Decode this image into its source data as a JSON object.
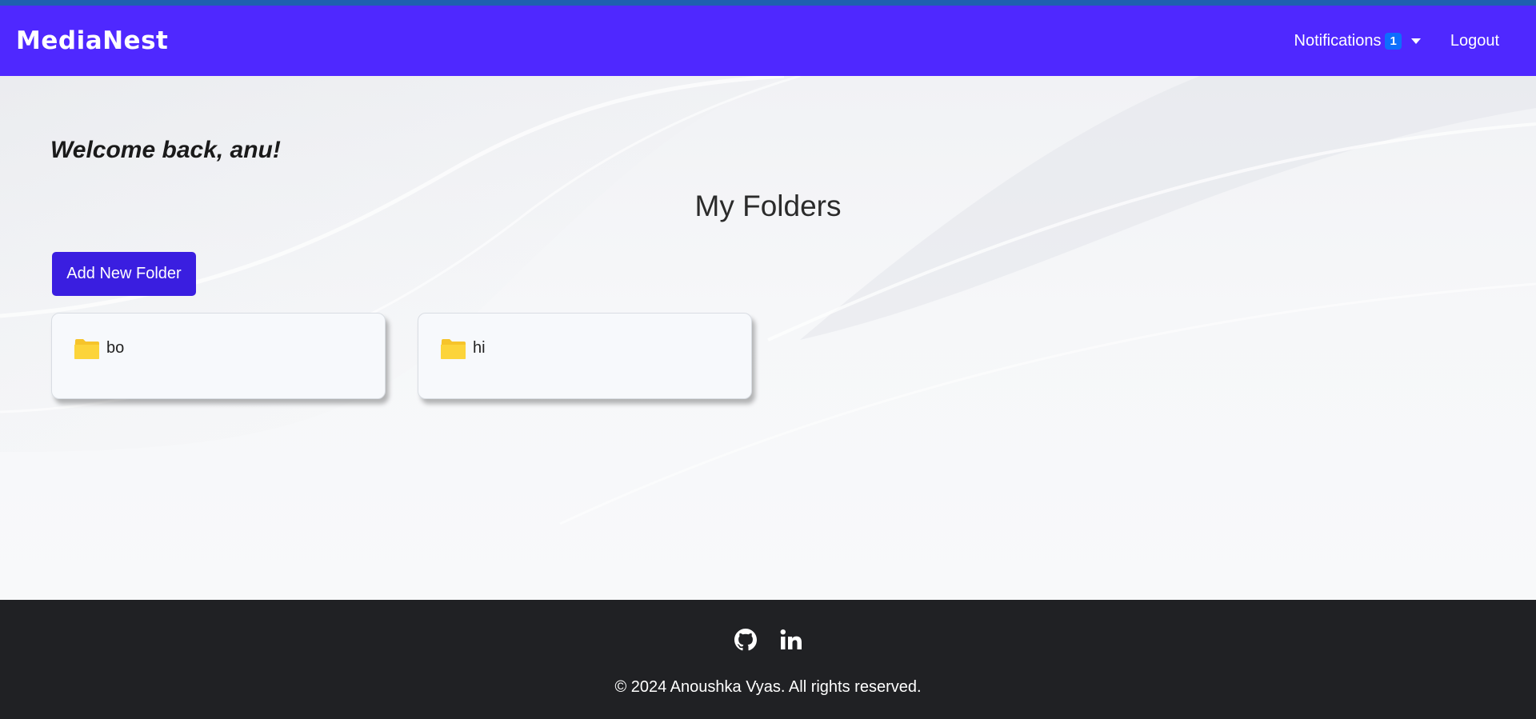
{
  "navbar": {
    "brand": "MediaNest",
    "notifications_label": "Notifications",
    "notifications_count": "1",
    "logout_label": "Logout"
  },
  "main": {
    "welcome": "Welcome back, anu!",
    "section_title": "My Folders",
    "add_folder_label": "Add New Folder",
    "folders": [
      {
        "name": "bo",
        "icon": "folder-icon"
      },
      {
        "name": "hi",
        "icon": "folder-icon"
      }
    ]
  },
  "footer": {
    "social": [
      "github-icon",
      "linkedin-icon"
    ],
    "copyright": "© 2024 Anoushka Vyas. All rights reserved."
  },
  "colors": {
    "navbar": "#4f28ff",
    "button": "#3a1ee0",
    "badge": "#0d6efd",
    "folder": "#f6c42b",
    "footer": "#202124"
  }
}
